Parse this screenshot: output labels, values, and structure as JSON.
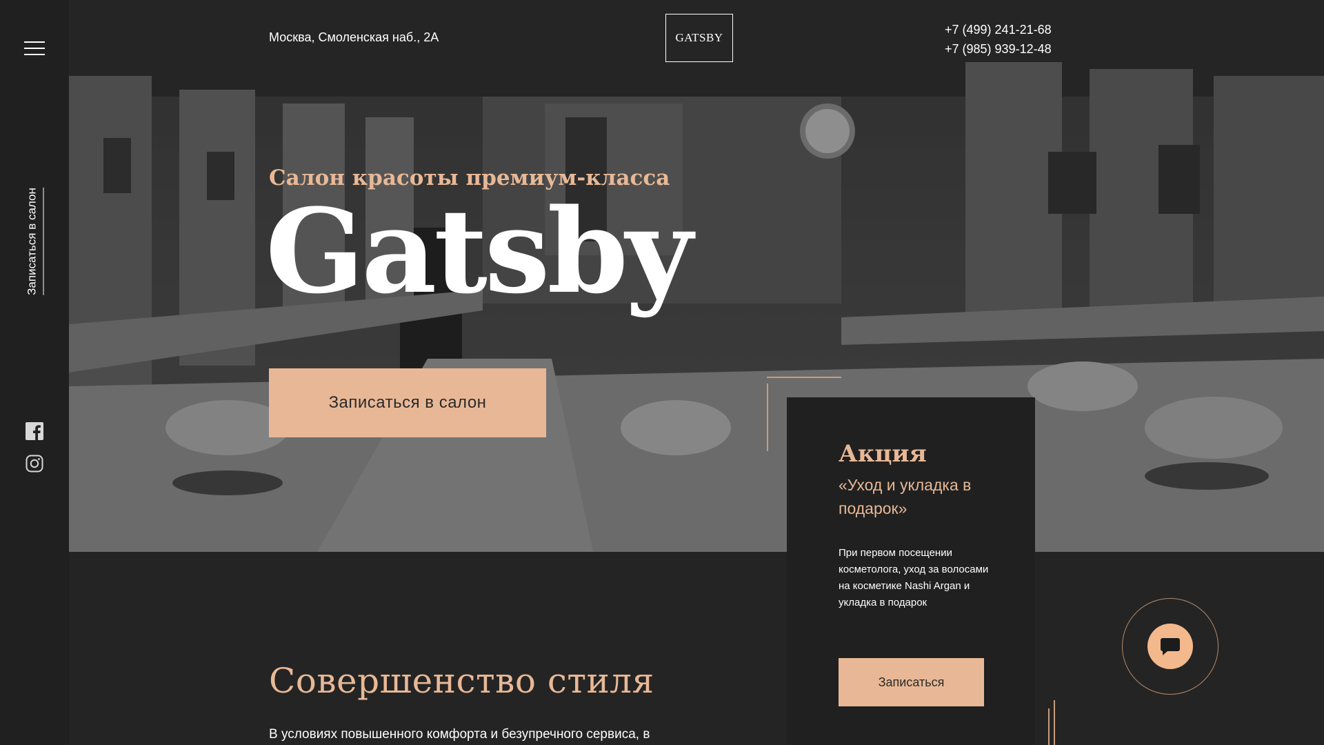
{
  "sidebar": {
    "cta_label": "Записаться в салон",
    "social": [
      "facebook-icon",
      "instagram-icon"
    ]
  },
  "header": {
    "address": "Москва, Смоленская наб., 2А",
    "logo": "GATSBY",
    "phones": [
      "+7 (499) 241-21-68",
      "+7 (985) 939-12-48"
    ]
  },
  "hero": {
    "subtitle": "Салон красоты премиум-класса",
    "title": "Gatsby",
    "button_label": "Записаться в салон"
  },
  "promo": {
    "title": "Акция",
    "subtitle": "«Уход и укладка в подарок»",
    "text": "При первом посещении косметолога, уход за волосами на косметике Nashi Argan и укладка в подарок",
    "button_label": "Записаться"
  },
  "section": {
    "title": "Совершенство стиля",
    "text": "В условиях повышенного комфорта и безупречного сервиса, в"
  },
  "chat": {
    "icon": "chat-icon"
  },
  "colors": {
    "accent": "#e8b896",
    "dark": "#242424",
    "sidebar": "#202020"
  }
}
